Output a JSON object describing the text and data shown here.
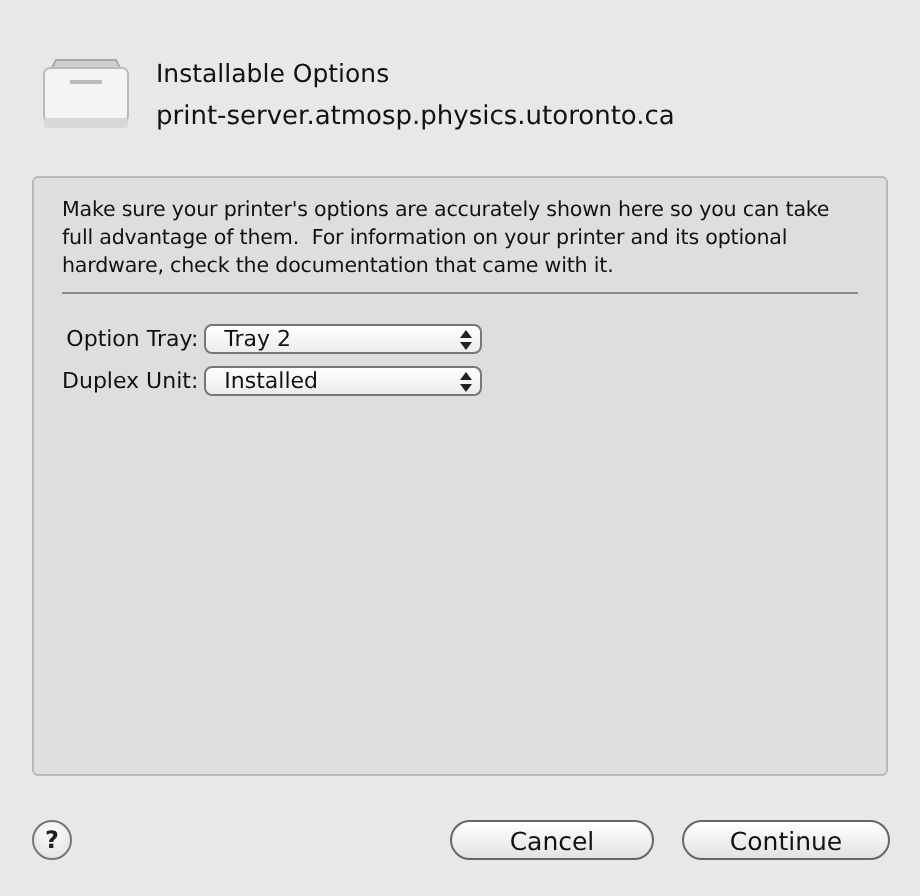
{
  "header": {
    "title": "Installable Options",
    "subtitle": "print-server.atmosp.physics.utoronto.ca"
  },
  "description": "Make sure your printer's options are accurately shown here so you can take full advantage of them.  For information on your printer and its optional hardware, check the documentation that came with it.",
  "options": [
    {
      "label": "Option Tray:",
      "value": "Tray 2"
    },
    {
      "label": "Duplex Unit:",
      "value": "Installed"
    }
  ],
  "help": "?",
  "buttons": [
    {
      "label": "Cancel",
      "kind": "secondary"
    },
    {
      "label": "Continue",
      "kind": "primary"
    }
  ]
}
